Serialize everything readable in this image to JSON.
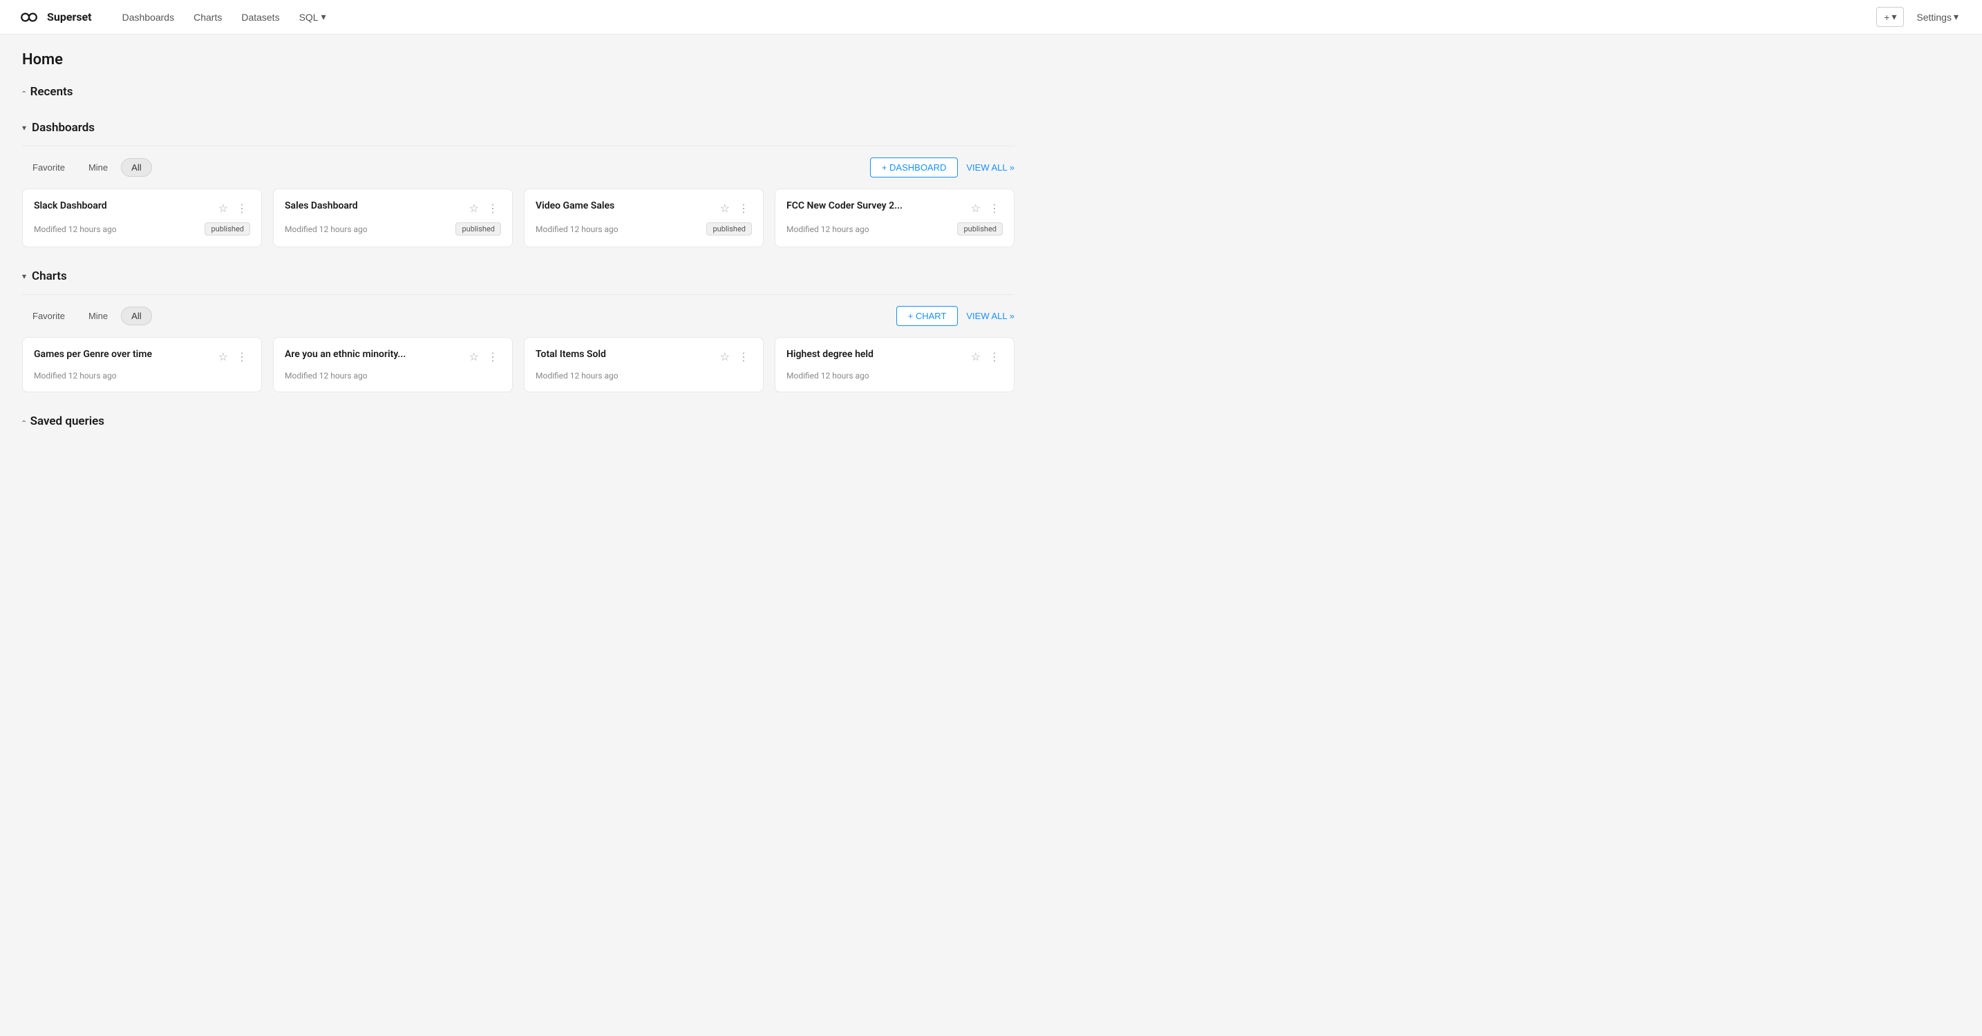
{
  "nav": {
    "brand": "Superset",
    "links": [
      "Dashboards",
      "Charts",
      "Datasets"
    ],
    "sql_label": "SQL",
    "sql_arrow": "▾",
    "plus_label": "+",
    "plus_arrow": "▾",
    "settings_label": "Settings",
    "settings_arrow": "▾"
  },
  "page": {
    "title": "Home"
  },
  "sections": {
    "recents": {
      "label": "Recents",
      "collapsed": true
    },
    "dashboards": {
      "label": "Dashboards",
      "collapsed": false,
      "filter_tabs": [
        "Favorite",
        "Mine",
        "All"
      ],
      "active_tab": "All",
      "add_btn": "+ DASHBOARD",
      "view_all": "VIEW ALL »",
      "cards": [
        {
          "title": "Slack Dashboard",
          "meta": "Modified 12 hours ago",
          "published": true
        },
        {
          "title": "Sales Dashboard",
          "meta": "Modified 12 hours ago",
          "published": true
        },
        {
          "title": "Video Game Sales",
          "meta": "Modified 12 hours ago",
          "published": true
        },
        {
          "title": "FCC New Coder Survey 2...",
          "meta": "Modified 12 hours ago",
          "published": true
        }
      ]
    },
    "charts": {
      "label": "Charts",
      "collapsed": false,
      "filter_tabs": [
        "Favorite",
        "Mine",
        "All"
      ],
      "active_tab": "All",
      "add_btn": "+ CHART",
      "view_all": "VIEW ALL »",
      "cards": [
        {
          "title": "Games per Genre over time",
          "meta": "Modified 12 hours ago",
          "published": false
        },
        {
          "title": "Are you an ethnic minority...",
          "meta": "Modified 12 hours ago",
          "published": false
        },
        {
          "title": "Total Items Sold",
          "meta": "Modified 12 hours ago",
          "published": false
        },
        {
          "title": "Highest degree held",
          "meta": "Modified 12 hours ago",
          "published": false
        }
      ]
    },
    "saved_queries": {
      "label": "Saved queries",
      "collapsed": true
    }
  },
  "labels": {
    "published": "published",
    "star_icon": "☆",
    "more_icon": "⋮",
    "chevron_down": "▾",
    "chevron_right": "›"
  }
}
